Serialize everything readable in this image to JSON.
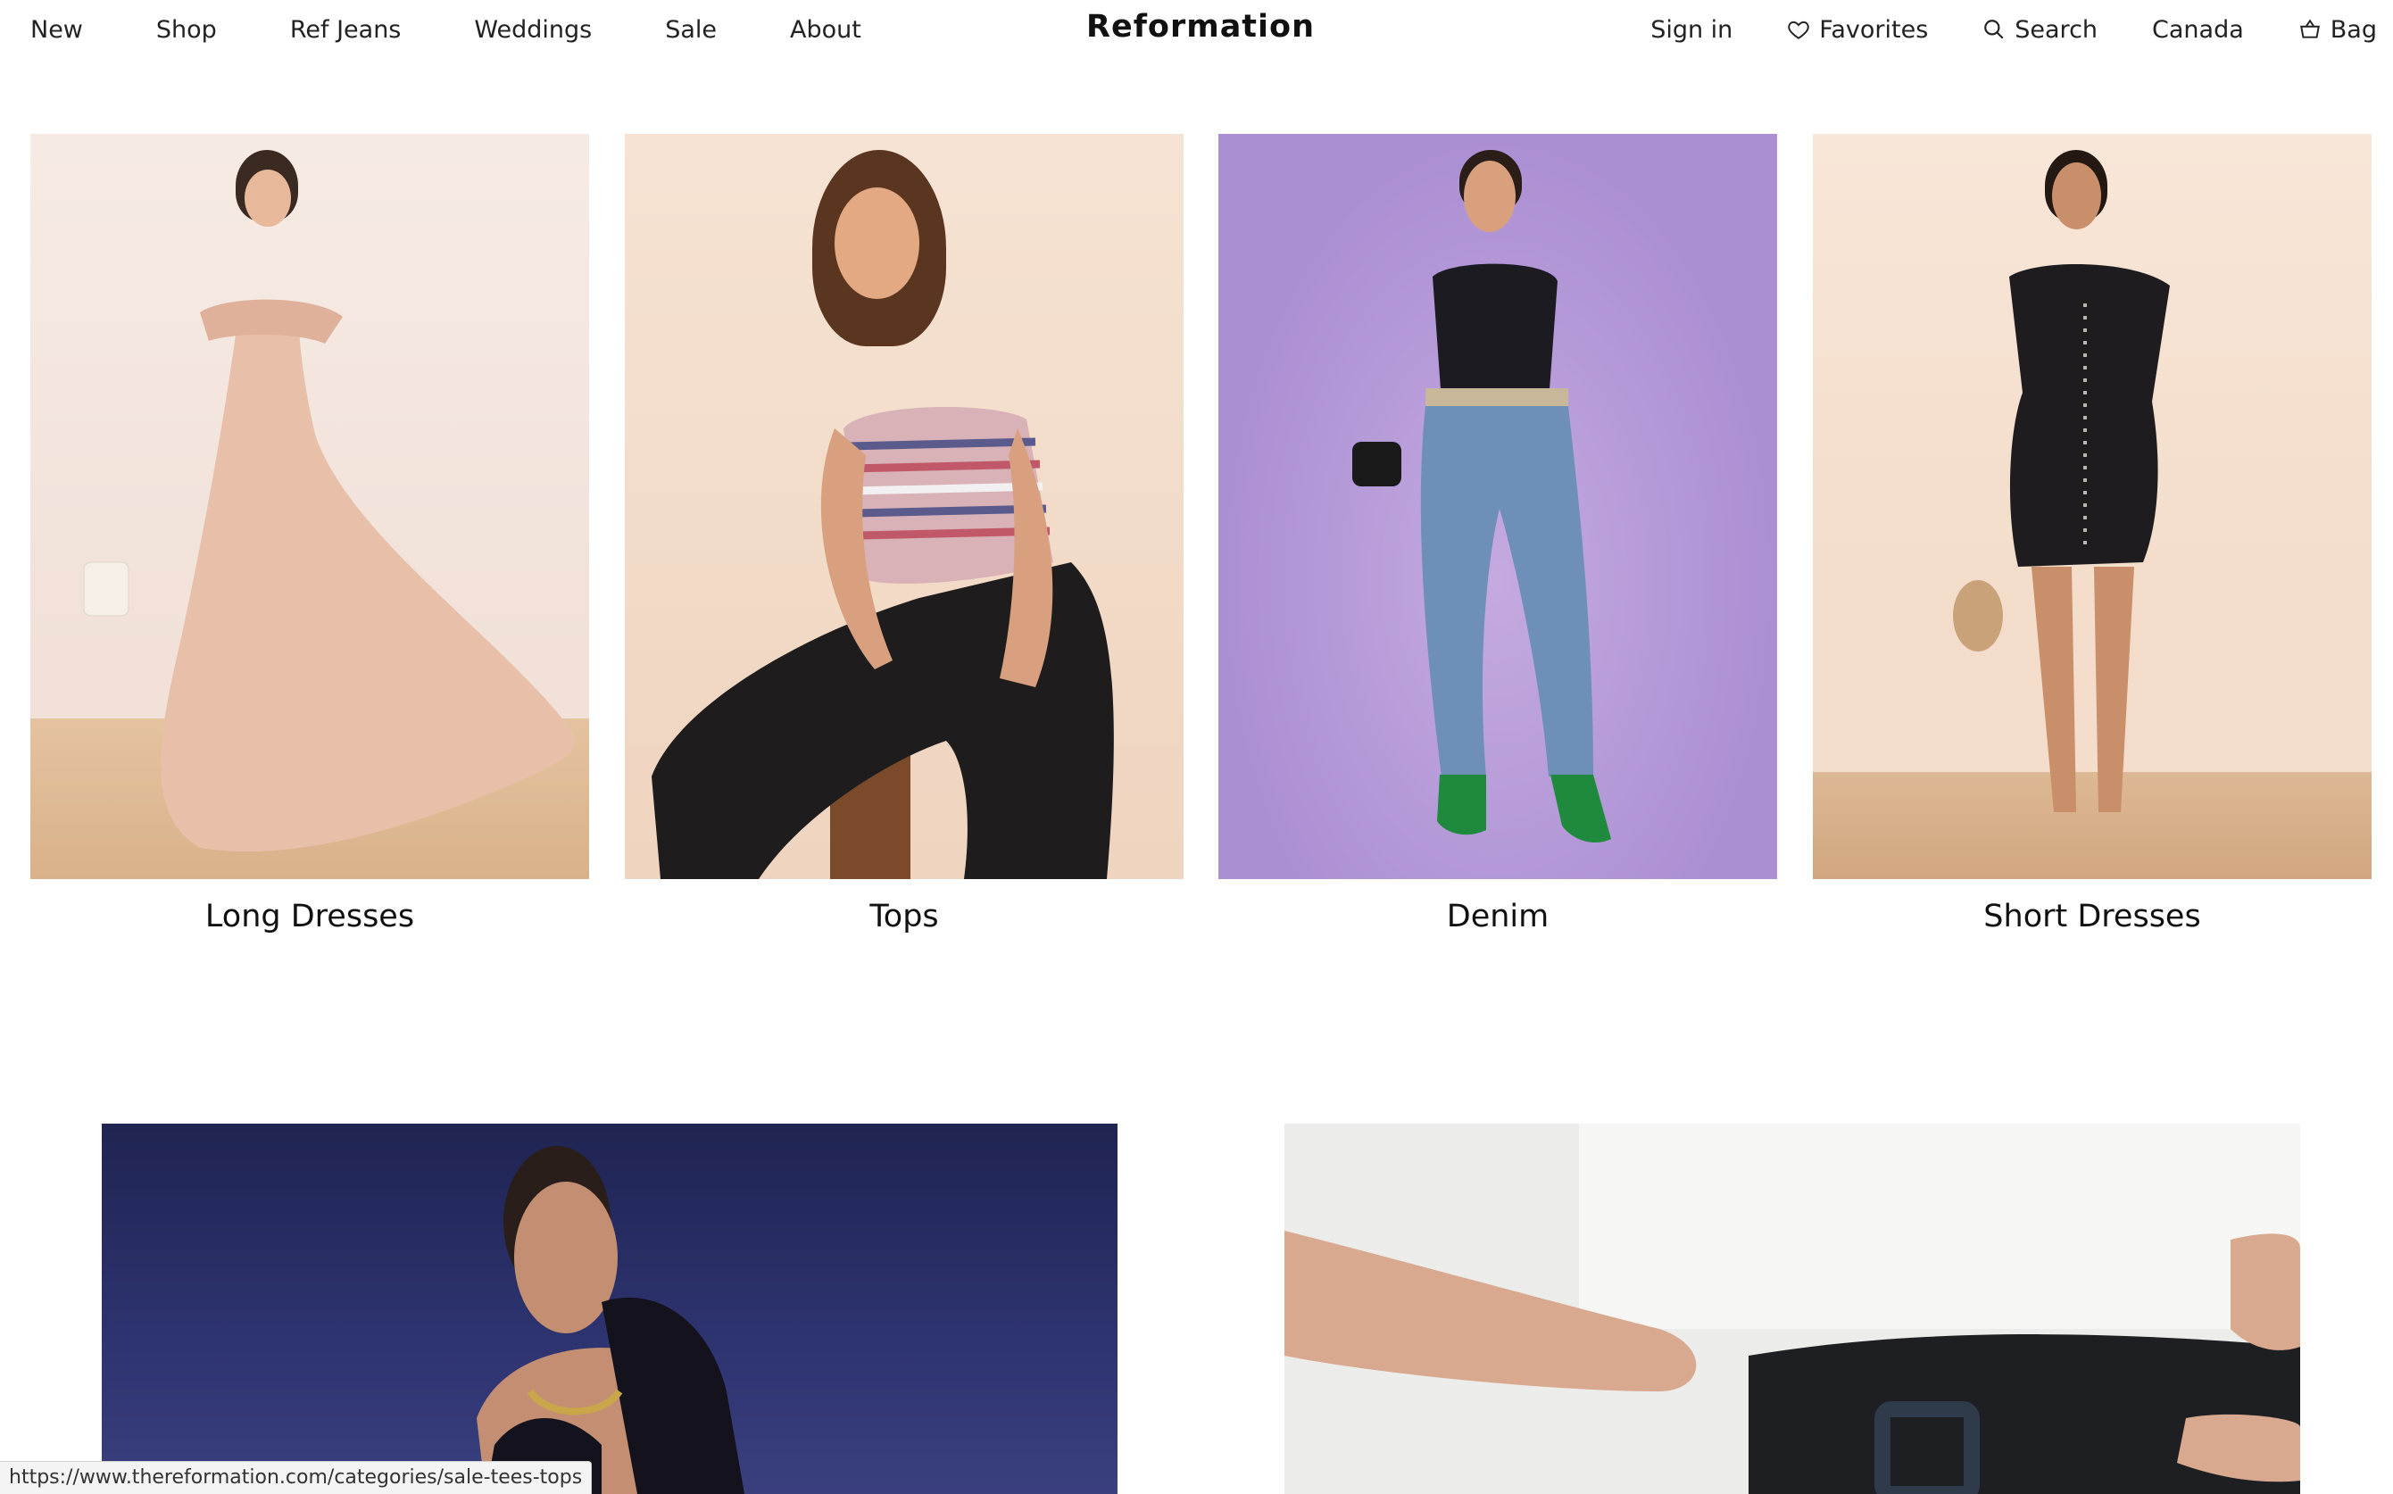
{
  "brand": "Reformation",
  "nav_left": [
    "New",
    "Shop",
    "Ref Jeans",
    "Weddings",
    "Sale",
    "About"
  ],
  "nav_right": {
    "sign_in": "Sign in",
    "favorites": "Favorites",
    "search": "Search",
    "region": "Canada",
    "bag": "Bag"
  },
  "categories": [
    {
      "label": "Long Dresses",
      "icon": "model-photo"
    },
    {
      "label": "Tops",
      "icon": "model-photo"
    },
    {
      "label": "Denim",
      "icon": "model-photo"
    },
    {
      "label": "Short Dresses",
      "icon": "model-photo"
    }
  ],
  "status_url": "https://www.thereformation.com/categories/sale-tees-tops",
  "colors": {
    "text": "#111111",
    "long_dresses_bg": "#f4e4dc",
    "tops_bg": "#f3dcc9",
    "denim_bg": "#b89bd8",
    "short_dresses_bg": "#f6e1d2",
    "banner_left_bg": "#2a2f6a",
    "banner_right_bg": "#ececea"
  }
}
